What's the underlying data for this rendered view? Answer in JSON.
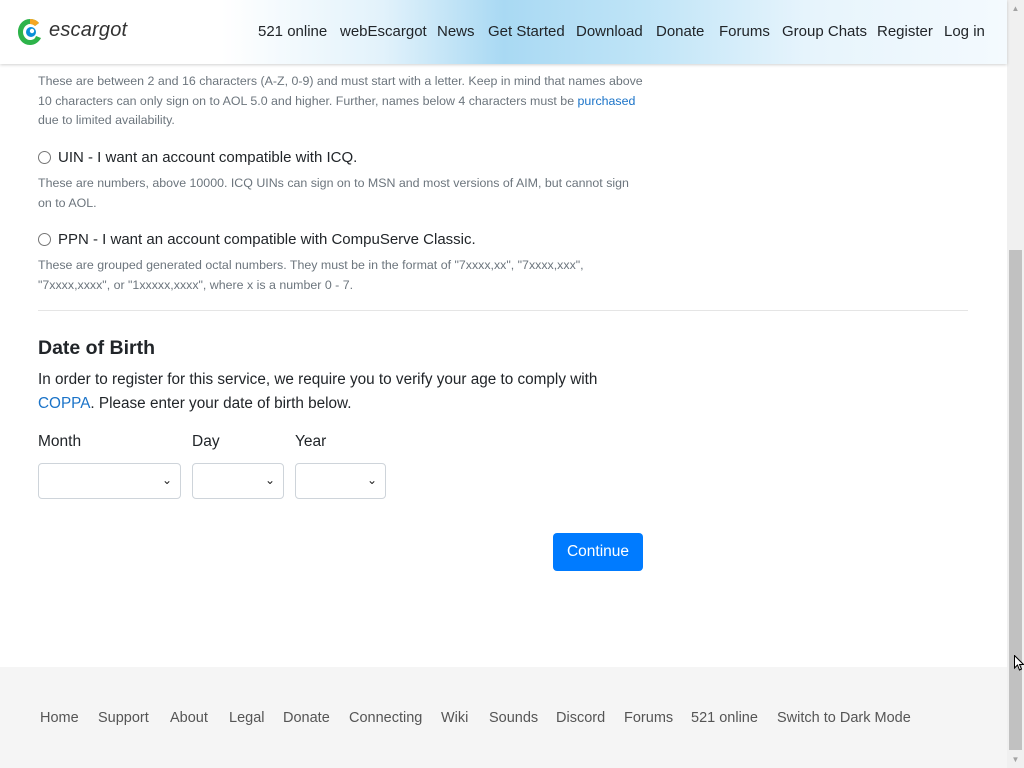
{
  "header": {
    "brand": "escargot",
    "nav": [
      {
        "label": "521 online"
      },
      {
        "label": "webEscargot"
      },
      {
        "label": "News"
      },
      {
        "label": "Get Started"
      },
      {
        "label": "Download"
      },
      {
        "label": "Donate"
      },
      {
        "label": "Forums"
      },
      {
        "label": "Group Chats"
      },
      {
        "label": "Register"
      },
      {
        "label": "Log in"
      }
    ]
  },
  "screenname": {
    "desc_part1": "These are between 2 and 16 characters (A-Z, 0-9) and must start with a letter. Keep in mind that names above 10 characters can only sign on to AOL 5.0 and higher. Further, names below 4 characters must be ",
    "desc_link": "purchased",
    "desc_part2": " due to limited availability."
  },
  "uin": {
    "label": "UIN - I want an account compatible with ICQ.",
    "desc": "These are numbers, above 10000. ICQ UINs can sign on to MSN and most versions of AIM, but cannot sign on to AOL."
  },
  "ppn": {
    "label": "PPN - I want an account compatible with CompuServe Classic.",
    "desc": "These are grouped generated octal numbers. They must be in the format of \"7xxxx,xx\", \"7xxxx,xxx\", \"7xxxx,xxxx\", or \"1xxxxx,xxxx\", where x is a number 0 - 7."
  },
  "dob": {
    "heading": "Date of Birth",
    "text_part1": "In order to register for this service, we require you to verify your age to comply with ",
    "text_link": "COPPA",
    "text_part2": ". Please enter your date of birth below.",
    "month_label": "Month",
    "day_label": "Day",
    "year_label": "Year",
    "month_value": "",
    "day_value": "",
    "year_value": ""
  },
  "continue_label": "Continue",
  "footer": {
    "links": [
      {
        "label": "Home"
      },
      {
        "label": "Support"
      },
      {
        "label": "About"
      },
      {
        "label": "Legal"
      },
      {
        "label": "Donate"
      },
      {
        "label": "Connecting"
      },
      {
        "label": "Wiki"
      },
      {
        "label": "Sounds"
      },
      {
        "label": "Discord"
      },
      {
        "label": "Forums"
      },
      {
        "label": "521 online"
      },
      {
        "label": "Switch to Dark Mode"
      }
    ]
  },
  "colors": {
    "primary": "#007bff",
    "link": "#1a73c8",
    "muted_text": "#6c757d",
    "footer_bg": "#f5f5f5"
  }
}
